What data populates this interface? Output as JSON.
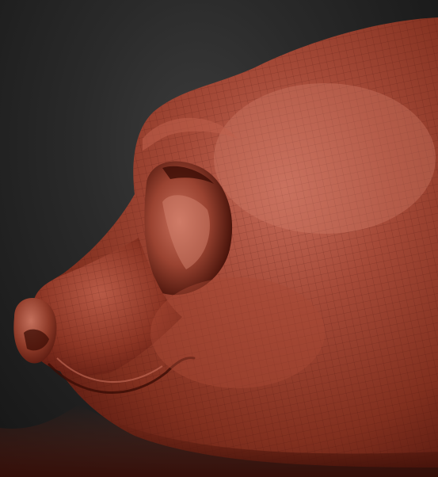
{
  "scene": {
    "background_color": "#242424",
    "clay_color": "#a0402d",
    "clay_highlight_color": "#d46a55",
    "clay_shadow_color": "#4a140c"
  }
}
